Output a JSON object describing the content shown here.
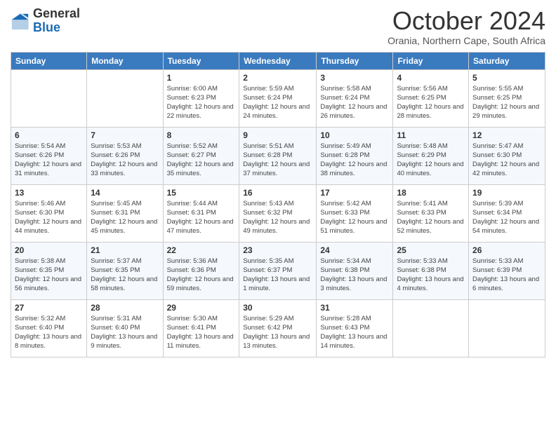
{
  "logo": {
    "general": "General",
    "blue": "Blue"
  },
  "header": {
    "month": "October 2024",
    "location": "Orania, Northern Cape, South Africa"
  },
  "days_of_week": [
    "Sunday",
    "Monday",
    "Tuesday",
    "Wednesday",
    "Thursday",
    "Friday",
    "Saturday"
  ],
  "weeks": [
    [
      {
        "day": "",
        "info": ""
      },
      {
        "day": "",
        "info": ""
      },
      {
        "day": "1",
        "info": "Sunrise: 6:00 AM\nSunset: 6:23 PM\nDaylight: 12 hours and 22 minutes."
      },
      {
        "day": "2",
        "info": "Sunrise: 5:59 AM\nSunset: 6:24 PM\nDaylight: 12 hours and 24 minutes."
      },
      {
        "day": "3",
        "info": "Sunrise: 5:58 AM\nSunset: 6:24 PM\nDaylight: 12 hours and 26 minutes."
      },
      {
        "day": "4",
        "info": "Sunrise: 5:56 AM\nSunset: 6:25 PM\nDaylight: 12 hours and 28 minutes."
      },
      {
        "day": "5",
        "info": "Sunrise: 5:55 AM\nSunset: 6:25 PM\nDaylight: 12 hours and 29 minutes."
      }
    ],
    [
      {
        "day": "6",
        "info": "Sunrise: 5:54 AM\nSunset: 6:26 PM\nDaylight: 12 hours and 31 minutes."
      },
      {
        "day": "7",
        "info": "Sunrise: 5:53 AM\nSunset: 6:26 PM\nDaylight: 12 hours and 33 minutes."
      },
      {
        "day": "8",
        "info": "Sunrise: 5:52 AM\nSunset: 6:27 PM\nDaylight: 12 hours and 35 minutes."
      },
      {
        "day": "9",
        "info": "Sunrise: 5:51 AM\nSunset: 6:28 PM\nDaylight: 12 hours and 37 minutes."
      },
      {
        "day": "10",
        "info": "Sunrise: 5:49 AM\nSunset: 6:28 PM\nDaylight: 12 hours and 38 minutes."
      },
      {
        "day": "11",
        "info": "Sunrise: 5:48 AM\nSunset: 6:29 PM\nDaylight: 12 hours and 40 minutes."
      },
      {
        "day": "12",
        "info": "Sunrise: 5:47 AM\nSunset: 6:30 PM\nDaylight: 12 hours and 42 minutes."
      }
    ],
    [
      {
        "day": "13",
        "info": "Sunrise: 5:46 AM\nSunset: 6:30 PM\nDaylight: 12 hours and 44 minutes."
      },
      {
        "day": "14",
        "info": "Sunrise: 5:45 AM\nSunset: 6:31 PM\nDaylight: 12 hours and 45 minutes."
      },
      {
        "day": "15",
        "info": "Sunrise: 5:44 AM\nSunset: 6:31 PM\nDaylight: 12 hours and 47 minutes."
      },
      {
        "day": "16",
        "info": "Sunrise: 5:43 AM\nSunset: 6:32 PM\nDaylight: 12 hours and 49 minutes."
      },
      {
        "day": "17",
        "info": "Sunrise: 5:42 AM\nSunset: 6:33 PM\nDaylight: 12 hours and 51 minutes."
      },
      {
        "day": "18",
        "info": "Sunrise: 5:41 AM\nSunset: 6:33 PM\nDaylight: 12 hours and 52 minutes."
      },
      {
        "day": "19",
        "info": "Sunrise: 5:39 AM\nSunset: 6:34 PM\nDaylight: 12 hours and 54 minutes."
      }
    ],
    [
      {
        "day": "20",
        "info": "Sunrise: 5:38 AM\nSunset: 6:35 PM\nDaylight: 12 hours and 56 minutes."
      },
      {
        "day": "21",
        "info": "Sunrise: 5:37 AM\nSunset: 6:35 PM\nDaylight: 12 hours and 58 minutes."
      },
      {
        "day": "22",
        "info": "Sunrise: 5:36 AM\nSunset: 6:36 PM\nDaylight: 12 hours and 59 minutes."
      },
      {
        "day": "23",
        "info": "Sunrise: 5:35 AM\nSunset: 6:37 PM\nDaylight: 13 hours and 1 minute."
      },
      {
        "day": "24",
        "info": "Sunrise: 5:34 AM\nSunset: 6:38 PM\nDaylight: 13 hours and 3 minutes."
      },
      {
        "day": "25",
        "info": "Sunrise: 5:33 AM\nSunset: 6:38 PM\nDaylight: 13 hours and 4 minutes."
      },
      {
        "day": "26",
        "info": "Sunrise: 5:33 AM\nSunset: 6:39 PM\nDaylight: 13 hours and 6 minutes."
      }
    ],
    [
      {
        "day": "27",
        "info": "Sunrise: 5:32 AM\nSunset: 6:40 PM\nDaylight: 13 hours and 8 minutes."
      },
      {
        "day": "28",
        "info": "Sunrise: 5:31 AM\nSunset: 6:40 PM\nDaylight: 13 hours and 9 minutes."
      },
      {
        "day": "29",
        "info": "Sunrise: 5:30 AM\nSunset: 6:41 PM\nDaylight: 13 hours and 11 minutes."
      },
      {
        "day": "30",
        "info": "Sunrise: 5:29 AM\nSunset: 6:42 PM\nDaylight: 13 hours and 13 minutes."
      },
      {
        "day": "31",
        "info": "Sunrise: 5:28 AM\nSunset: 6:43 PM\nDaylight: 13 hours and 14 minutes."
      },
      {
        "day": "",
        "info": ""
      },
      {
        "day": "",
        "info": ""
      }
    ]
  ]
}
